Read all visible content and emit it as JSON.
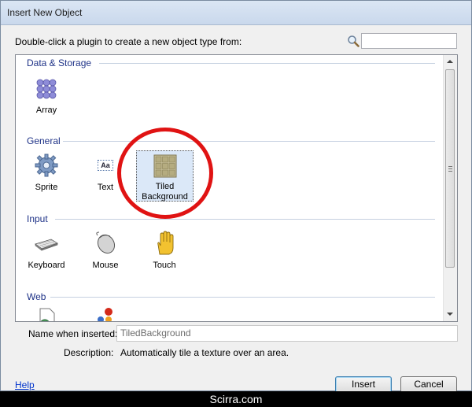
{
  "window": {
    "title": "Insert New Object"
  },
  "instruction": "Double-click a plugin to create a new object type from:",
  "search": {
    "icon": "search-icon",
    "value": ""
  },
  "groups": [
    {
      "label": "Data & Storage",
      "items": [
        {
          "label": "Array",
          "icon": "array-icon"
        }
      ]
    },
    {
      "label": "General",
      "items": [
        {
          "label": "Sprite",
          "icon": "gear-sprite-icon"
        },
        {
          "label": "Text",
          "icon": "text-icon",
          "icon_text": "Aa"
        },
        {
          "label": "Tiled\nBackground",
          "icon": "tiled-background-icon",
          "selected": true
        }
      ]
    },
    {
      "label": "Input",
      "items": [
        {
          "label": "Keyboard",
          "icon": "keyboard-icon"
        },
        {
          "label": "Mouse",
          "icon": "mouse-icon"
        },
        {
          "label": "Touch",
          "icon": "hand-touch-icon"
        }
      ]
    },
    {
      "label": "Web",
      "items": [
        {
          "label": "",
          "icon": "web-document-icon"
        },
        {
          "label": "",
          "icon": "web-browser-icon"
        }
      ]
    }
  ],
  "name_field": {
    "label": "Name when inserted:",
    "value": "TiledBackground"
  },
  "description": {
    "label": "Description:",
    "value": "Automatically tile a texture over an area."
  },
  "help_link": "Help",
  "buttons": {
    "insert": "Insert",
    "cancel": "Cancel"
  },
  "footer": "Scirra.com",
  "colors": {
    "highlight_circle": "#e01313",
    "group_header": "#1e3287",
    "selection": "#dbe8f8"
  }
}
